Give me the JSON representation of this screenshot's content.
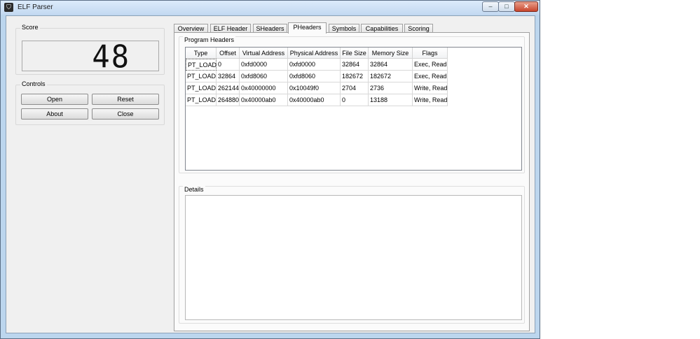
{
  "window": {
    "title": "ELF Parser",
    "min_glyph": "–",
    "max_glyph": "□",
    "close_glyph": "✕"
  },
  "score": {
    "group_label": "Score",
    "value": "48"
  },
  "controls": {
    "group_label": "Controls",
    "open": "Open",
    "reset": "Reset",
    "about": "About",
    "close": "Close"
  },
  "tabs": [
    {
      "label": "Overview",
      "active": false
    },
    {
      "label": "ELF Header",
      "active": false
    },
    {
      "label": "SHeaders",
      "active": false
    },
    {
      "label": "PHeaders",
      "active": true
    },
    {
      "label": "Symbols",
      "active": false
    },
    {
      "label": "Capabilities",
      "active": false
    },
    {
      "label": "Scoring",
      "active": false
    }
  ],
  "program_headers": {
    "group_label": "Program Headers",
    "columns": [
      "Type",
      "Offset",
      "Virtual Address",
      "Physical Address",
      "File Size",
      "Memory Size",
      "Flags"
    ],
    "rows": [
      [
        "PT_LOAD",
        "0",
        "0xfd0000",
        "0xfd0000",
        "32864",
        "32864",
        "Exec, Read"
      ],
      [
        "PT_LOAD",
        "32864",
        "0xfd8060",
        "0xfd8060",
        "182672",
        "182672",
        "Exec, Read"
      ],
      [
        "PT_LOAD",
        "262144",
        "0x40000000",
        "0x10049f0",
        "2704",
        "2736",
        "Write, Read"
      ],
      [
        "PT_LOAD",
        "264880",
        "0x40000ab0",
        "0x40000ab0",
        "0",
        "13188",
        "Write, Read"
      ]
    ]
  },
  "details": {
    "group_label": "Details"
  },
  "colors": {
    "titlebar": "#c3d9f1",
    "close_button": "#c8452d",
    "client_bg": "#f0f0f0"
  }
}
